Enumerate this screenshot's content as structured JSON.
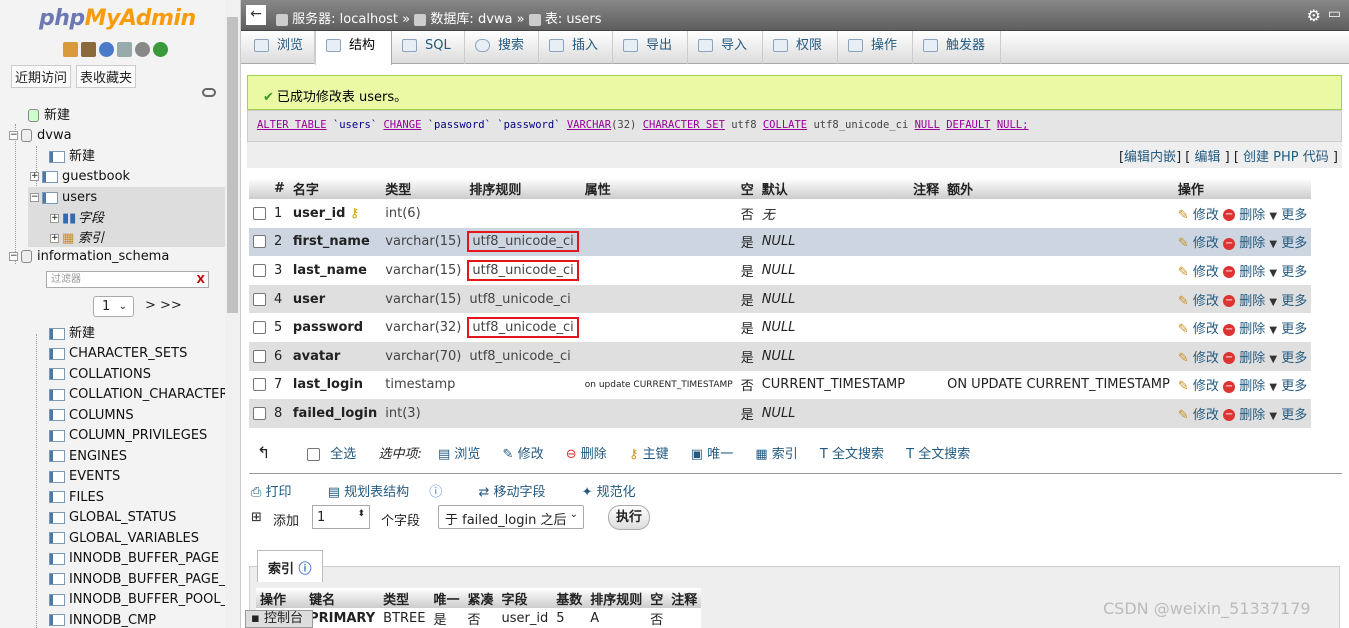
{
  "app": {
    "logo_a": "php",
    "logo_b": "MyAdmin"
  },
  "left": {
    "tabs": [
      "近期访问",
      "表收藏夹"
    ],
    "tree": {
      "new_root": "新建",
      "db_dvwa": "dvwa",
      "new_dvwa": "新建",
      "tbl_guestbook": "guestbook",
      "tbl_users": "users",
      "fields": "字段",
      "indexes": "索引",
      "db_is": "information_schema",
      "filter_placeholder": "过滤器",
      "filter_clear": "X",
      "page_value": "1",
      "page_next": "> >>",
      "new_is": "新建",
      "is_tables": [
        "CHARACTER_SETS",
        "COLLATIONS",
        "COLLATION_CHARACTER",
        "COLUMNS",
        "COLUMN_PRIVILEGES",
        "ENGINES",
        "EVENTS",
        "FILES",
        "GLOBAL_STATUS",
        "GLOBAL_VARIABLES",
        "INNODB_BUFFER_PAGE",
        "INNODB_BUFFER_PAGE_",
        "INNODB_BUFFER_POOL_",
        "INNODB_CMP"
      ]
    }
  },
  "topbar": {
    "back": "←",
    "server_label": "服务器:",
    "server": "localhost",
    "db_label": "数据库:",
    "db": "dvwa",
    "table_label": "表:",
    "table": "users",
    "sep": "»"
  },
  "tabs": [
    "浏览",
    "结构",
    "SQL",
    "搜索",
    "插入",
    "导出",
    "导入",
    "权限",
    "操作",
    "触发器"
  ],
  "success": "已成功修改表 users。",
  "sql": {
    "t1": "ALTER TABLE",
    "t2": "`users`",
    "t3": "CHANGE",
    "t4": "`password`",
    "t5": "`password`",
    "t6": "VARCHAR",
    "t7": "(32)",
    "t8": "CHARACTER SET",
    "t9": "utf8",
    "t10": "COLLATE",
    "t11": "utf8_unicode_ci",
    "t12": "NULL",
    "t13": "DEFAULT",
    "t14": "NULL;"
  },
  "sql_links": {
    "edit_inline": "编辑内嵌",
    "edit": "编辑",
    "php": "创建 PHP 代码"
  },
  "structure": {
    "headers": [
      "#",
      "名字",
      "类型",
      "排序规则",
      "属性",
      "空",
      "默认",
      "注释",
      "额外",
      "操作"
    ],
    "rows": [
      {
        "n": "1",
        "name": "user_id",
        "type": "int(6)",
        "coll": "",
        "attr": "",
        "null": "否",
        "def": "无",
        "extra": ""
      },
      {
        "n": "2",
        "name": "first_name",
        "type": "varchar(15)",
        "coll": "utf8_unicode_ci",
        "attr": "",
        "null": "是",
        "def": "NULL",
        "extra": ""
      },
      {
        "n": "3",
        "name": "last_name",
        "type": "varchar(15)",
        "coll": "utf8_unicode_ci",
        "attr": "",
        "null": "是",
        "def": "NULL",
        "extra": ""
      },
      {
        "n": "4",
        "name": "user",
        "type": "varchar(15)",
        "coll": "utf8_unicode_ci",
        "attr": "",
        "null": "是",
        "def": "NULL",
        "extra": ""
      },
      {
        "n": "5",
        "name": "password",
        "type": "varchar(32)",
        "coll": "utf8_unicode_ci",
        "attr": "",
        "null": "是",
        "def": "NULL",
        "extra": ""
      },
      {
        "n": "6",
        "name": "avatar",
        "type": "varchar(70)",
        "coll": "utf8_unicode_ci",
        "attr": "",
        "null": "是",
        "def": "NULL",
        "extra": ""
      },
      {
        "n": "7",
        "name": "last_login",
        "type": "timestamp",
        "coll": "",
        "attr": "on update CURRENT_TIMESTAMP",
        "null": "否",
        "def": "CURRENT_TIMESTAMP",
        "extra": "ON UPDATE CURRENT_TIMESTAMP"
      },
      {
        "n": "8",
        "name": "failed_login",
        "type": "int(3)",
        "coll": "",
        "attr": "",
        "null": "是",
        "def": "NULL",
        "extra": ""
      }
    ],
    "actions": {
      "edit": "修改",
      "drop": "删除",
      "more": "更多"
    }
  },
  "selbar": {
    "check_all": "全选",
    "with_selected": "选中项:",
    "browse": "浏览",
    "edit": "修改",
    "drop": "删除",
    "primary": "主键",
    "unique": "唯一",
    "index": "索引",
    "fulltext1": "全文搜索",
    "fulltext2": "全文搜索"
  },
  "tools": {
    "print": "打印",
    "propose": "规划表结构",
    "move": "移动字段",
    "normalize": "规范化"
  },
  "addrow": {
    "add": "添加",
    "count": "1",
    "fields": "个字段",
    "after": "于 failed_login 之后",
    "go": "执行"
  },
  "indexes": {
    "tab": "索引",
    "headers": [
      "操作",
      "键名",
      "类型",
      "唯一",
      "紧凑",
      "字段",
      "基数",
      "排序规则",
      "空",
      "注释"
    ],
    "row": {
      "drop": "删除",
      "key": "PRIMARY",
      "type": "BTREE",
      "unique": "是",
      "packed": "否",
      "field": "user_id",
      "card": "5",
      "coll": "A",
      "null": "否",
      "comment": ""
    }
  },
  "console": "控制台",
  "watermark": "CSDN @weixin_51337179"
}
